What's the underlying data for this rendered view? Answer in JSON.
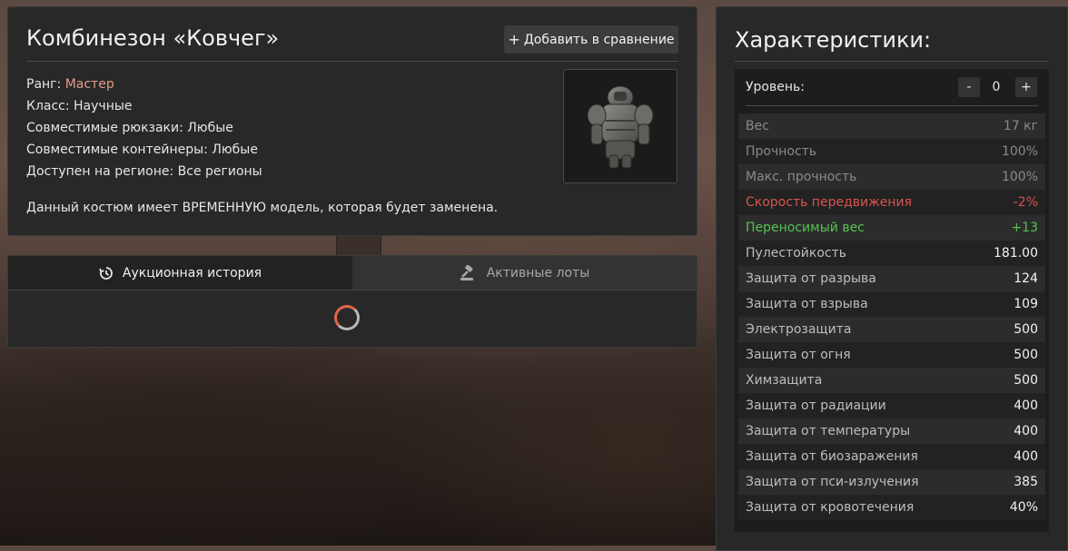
{
  "item": {
    "title": "Комбинезон «Ковчег»",
    "compare_button": "Добавить в сравнение",
    "rank_label": "Ранг:",
    "rank_value": "Мастер",
    "class_line": "Класс: Научные",
    "backpacks_line": "Совместимые рюкзаки: Любые",
    "containers_line": "Совместимые контейнеры: Любые",
    "region_line": "Доступен на регионе: Все регионы",
    "description": "Данный костюм имеет ВРЕМЕННУЮ модель, которая будет заменена."
  },
  "auction": {
    "tab_history": "Аукционная история",
    "tab_lots": "Активные лоты"
  },
  "stats": {
    "title": "Характеристики:",
    "level_label": "Уровень:",
    "level_minus": "-",
    "level_value": "0",
    "level_plus": "+",
    "rows": [
      {
        "label": "Вес",
        "value": "17 кг",
        "tone": "muted"
      },
      {
        "label": "Прочность",
        "value": "100%",
        "tone": "muted"
      },
      {
        "label": "Макс. прочность",
        "value": "100%",
        "tone": "muted"
      },
      {
        "label": "Скорость передвижения",
        "value": "-2%",
        "tone": "red"
      },
      {
        "label": "Переносимый вес",
        "value": "+13",
        "tone": "green"
      },
      {
        "label": "Пулестойкость",
        "value": "181.00",
        "tone": "normal"
      },
      {
        "label": "Защита от разрыва",
        "value": "124",
        "tone": "normal"
      },
      {
        "label": "Защита от взрыва",
        "value": "109",
        "tone": "normal"
      },
      {
        "label": "Электрозащита",
        "value": "500",
        "tone": "normal"
      },
      {
        "label": "Защита от огня",
        "value": "500",
        "tone": "normal"
      },
      {
        "label": "Химзащита",
        "value": "500",
        "tone": "normal"
      },
      {
        "label": "Защита от радиации",
        "value": "400",
        "tone": "normal"
      },
      {
        "label": "Защита от температуры",
        "value": "400",
        "tone": "normal"
      },
      {
        "label": "Защита от биозаражения",
        "value": "400",
        "tone": "normal"
      },
      {
        "label": "Защита от пси-излучения",
        "value": "385",
        "tone": "normal"
      },
      {
        "label": "Защита от кровотечения",
        "value": "40%",
        "tone": "normal"
      }
    ]
  },
  "colors": {
    "rank": "#e59a8c",
    "negative": "#d9534f",
    "positive": "#55c152",
    "spinner_accent": "#e0674c"
  },
  "icons": {
    "compare": "plus-icon",
    "history": "history-icon",
    "lots": "gavel-icon",
    "loading": "loading-spinner"
  }
}
